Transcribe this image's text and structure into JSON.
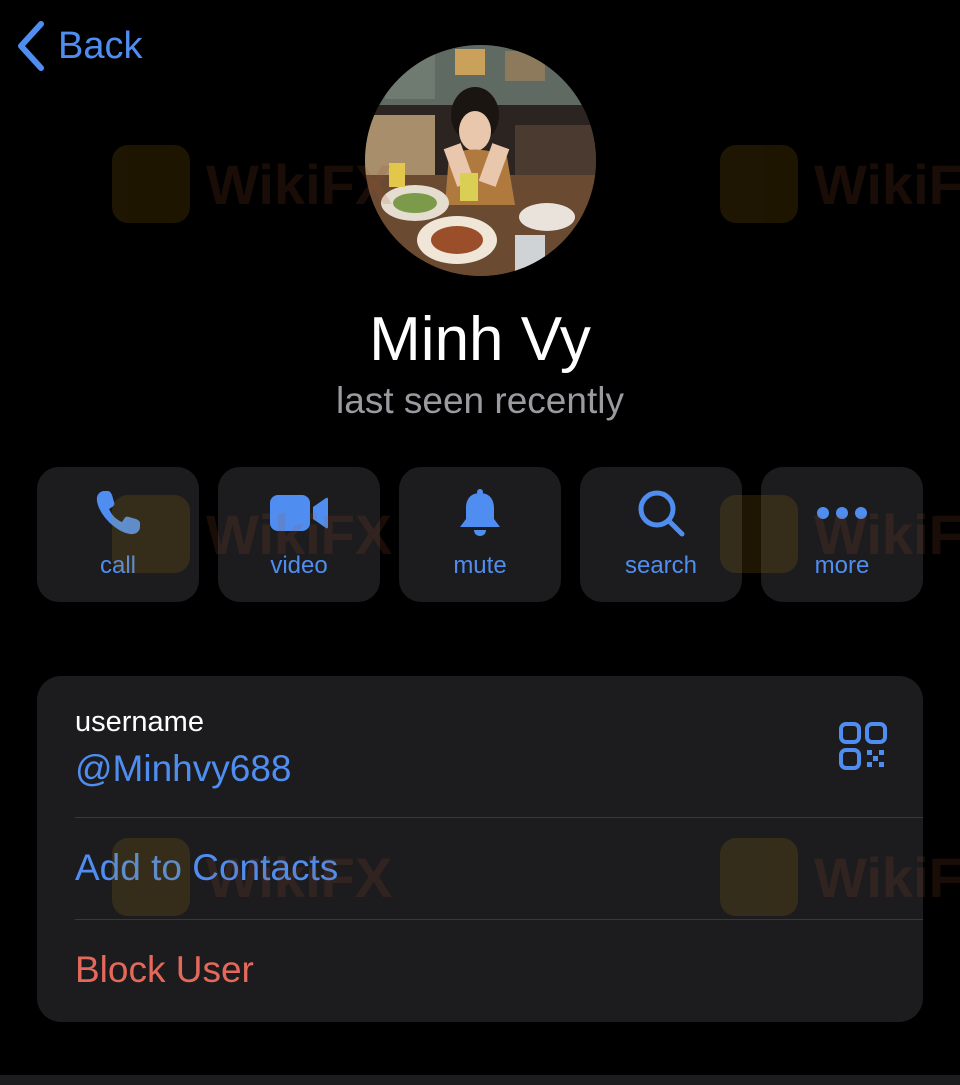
{
  "nav": {
    "back_label": "Back"
  },
  "profile": {
    "name": "Minh Vy",
    "status": "last seen recently"
  },
  "actions": [
    {
      "label": "call",
      "icon": "phone-icon"
    },
    {
      "label": "video",
      "icon": "video-camera-icon"
    },
    {
      "label": "mute",
      "icon": "bell-icon"
    },
    {
      "label": "search",
      "icon": "search-icon"
    },
    {
      "label": "more",
      "icon": "more-dots-icon"
    }
  ],
  "info": {
    "username_caption": "username",
    "username_value": "@Minhvy688",
    "qr_icon": "qr-code-icon",
    "add_contact_label": "Add to Contacts",
    "block_label": "Block User"
  },
  "watermark": {
    "text": "WikiFX"
  },
  "colors": {
    "background": "#000000",
    "card": "#1c1c1e",
    "accent": "#4f8ef0",
    "destructive": "#e4695a",
    "secondary_text": "#9a9aa0"
  }
}
